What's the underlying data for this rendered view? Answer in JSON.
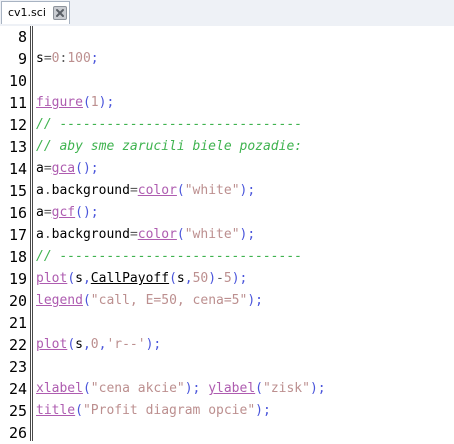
{
  "tab": {
    "label": "cv1.sci"
  },
  "lines": [
    {
      "num": "8",
      "tokens": []
    },
    {
      "num": "9",
      "tokens": [
        {
          "t": "id",
          "v": "s"
        },
        {
          "t": "op",
          "v": "="
        },
        {
          "t": "num",
          "v": "0"
        },
        {
          "t": "op",
          "v": ":"
        },
        {
          "t": "num",
          "v": "100"
        },
        {
          "t": "punct",
          "v": ";"
        }
      ]
    },
    {
      "num": "10",
      "tokens": []
    },
    {
      "num": "11",
      "tokens": [
        {
          "t": "fn",
          "v": "figure"
        },
        {
          "t": "punct",
          "v": "("
        },
        {
          "t": "num",
          "v": "1"
        },
        {
          "t": "punct",
          "v": ")"
        },
        {
          "t": "punct",
          "v": ";"
        }
      ]
    },
    {
      "num": "12",
      "tokens": [
        {
          "t": "com",
          "v": "// -------------------------------"
        }
      ]
    },
    {
      "num": "13",
      "tokens": [
        {
          "t": "com",
          "v": "// aby sme zarucili biele pozadie:"
        }
      ]
    },
    {
      "num": "14",
      "tokens": [
        {
          "t": "id",
          "v": "a"
        },
        {
          "t": "op",
          "v": "="
        },
        {
          "t": "fn",
          "v": "gca"
        },
        {
          "t": "punct",
          "v": "("
        },
        {
          "t": "punct",
          "v": ")"
        },
        {
          "t": "punct",
          "v": ";"
        }
      ]
    },
    {
      "num": "15",
      "tokens": [
        {
          "t": "id",
          "v": "a"
        },
        {
          "t": "op",
          "v": "."
        },
        {
          "t": "prop",
          "v": "background"
        },
        {
          "t": "op",
          "v": "="
        },
        {
          "t": "fn",
          "v": "color"
        },
        {
          "t": "punct",
          "v": "("
        },
        {
          "t": "str",
          "v": "\"white\""
        },
        {
          "t": "punct",
          "v": ")"
        },
        {
          "t": "punct",
          "v": ";"
        }
      ]
    },
    {
      "num": "16",
      "tokens": [
        {
          "t": "id",
          "v": "a"
        },
        {
          "t": "op",
          "v": "="
        },
        {
          "t": "fn",
          "v": "gcf"
        },
        {
          "t": "punct",
          "v": "("
        },
        {
          "t": "punct",
          "v": ")"
        },
        {
          "t": "punct",
          "v": ";"
        }
      ]
    },
    {
      "num": "17",
      "tokens": [
        {
          "t": "id",
          "v": "a"
        },
        {
          "t": "op",
          "v": "."
        },
        {
          "t": "prop",
          "v": "background"
        },
        {
          "t": "op",
          "v": "="
        },
        {
          "t": "fn",
          "v": "color"
        },
        {
          "t": "punct",
          "v": "("
        },
        {
          "t": "str",
          "v": "\"white\""
        },
        {
          "t": "punct",
          "v": ")"
        },
        {
          "t": "punct",
          "v": ";"
        }
      ]
    },
    {
      "num": "18",
      "tokens": [
        {
          "t": "com",
          "v": "// -------------------------------"
        }
      ]
    },
    {
      "num": "19",
      "tokens": [
        {
          "t": "fn",
          "v": "plot"
        },
        {
          "t": "punct",
          "v": "("
        },
        {
          "t": "id",
          "v": "s"
        },
        {
          "t": "punct",
          "v": ","
        },
        {
          "t": "ufn",
          "v": "CallPayoff"
        },
        {
          "t": "punct",
          "v": "("
        },
        {
          "t": "id",
          "v": "s"
        },
        {
          "t": "punct",
          "v": ","
        },
        {
          "t": "num",
          "v": "50"
        },
        {
          "t": "punct",
          "v": ")"
        },
        {
          "t": "op",
          "v": "-"
        },
        {
          "t": "num",
          "v": "5"
        },
        {
          "t": "punct",
          "v": ")"
        },
        {
          "t": "punct",
          "v": ";"
        }
      ]
    },
    {
      "num": "20",
      "tokens": [
        {
          "t": "fn",
          "v": "legend"
        },
        {
          "t": "punct",
          "v": "("
        },
        {
          "t": "str",
          "v": "\"call, E=50, cena=5\""
        },
        {
          "t": "punct",
          "v": ")"
        },
        {
          "t": "punct",
          "v": ";"
        }
      ]
    },
    {
      "num": "21",
      "tokens": []
    },
    {
      "num": "22",
      "tokens": [
        {
          "t": "fn",
          "v": "plot"
        },
        {
          "t": "punct",
          "v": "("
        },
        {
          "t": "id",
          "v": "s"
        },
        {
          "t": "punct",
          "v": ","
        },
        {
          "t": "num",
          "v": "0"
        },
        {
          "t": "punct",
          "v": ","
        },
        {
          "t": "str",
          "v": "'r--'"
        },
        {
          "t": "punct",
          "v": ")"
        },
        {
          "t": "punct",
          "v": ";"
        }
      ]
    },
    {
      "num": "23",
      "tokens": []
    },
    {
      "num": "24",
      "tokens": [
        {
          "t": "fn",
          "v": "xlabel"
        },
        {
          "t": "punct",
          "v": "("
        },
        {
          "t": "str",
          "v": "\"cena akcie\""
        },
        {
          "t": "punct",
          "v": ")"
        },
        {
          "t": "punct",
          "v": ";"
        },
        {
          "t": "id",
          "v": " "
        },
        {
          "t": "fn",
          "v": "ylabel"
        },
        {
          "t": "punct",
          "v": "("
        },
        {
          "t": "str",
          "v": "\"zisk\""
        },
        {
          "t": "punct",
          "v": ")"
        },
        {
          "t": "punct",
          "v": ";"
        }
      ]
    },
    {
      "num": "25",
      "tokens": [
        {
          "t": "fn",
          "v": "title"
        },
        {
          "t": "punct",
          "v": "("
        },
        {
          "t": "str",
          "v": "\"Profit diagram opcie\""
        },
        {
          "t": "punct",
          "v": ")"
        },
        {
          "t": "punct",
          "v": ";"
        }
      ]
    },
    {
      "num": "26",
      "tokens": []
    }
  ]
}
